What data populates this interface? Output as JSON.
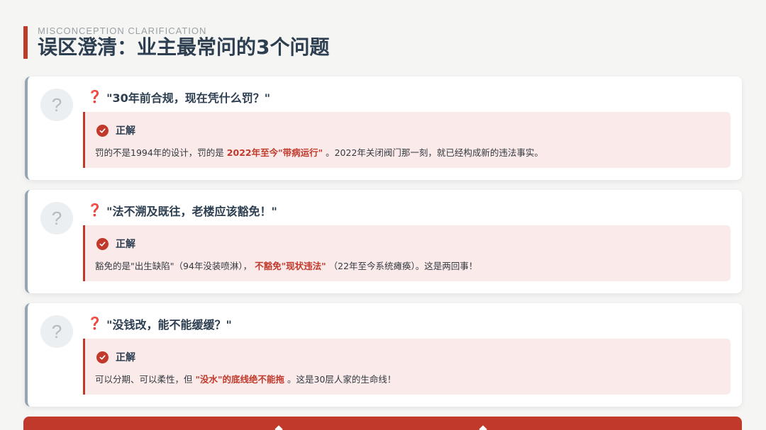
{
  "header": {
    "subtitle": "MISCONCEPTION CLARIFICATION",
    "title": "误区澄清：业主最常问的3个问题"
  },
  "cards": [
    {
      "question_mark": "?",
      "question_icon": "❓",
      "question": "\"30年前合规，现在凭什么罚？\"",
      "answer_label": "正解",
      "answer_before": "罚的不是1994年的设计，罚的是 ",
      "answer_highlight": "2022年至今\"带病运行\"",
      "answer_after": " 。2022年关闭阀门那一刻，就已经构成新的违法事实。"
    },
    {
      "question_mark": "?",
      "question_icon": "❓",
      "question": "\"法不溯及既往，老楼应该豁免！\"",
      "answer_label": "正解",
      "answer_before": "豁免的是\"出生缺陷\"（94年没装喷淋）， ",
      "answer_highlight": "不豁免\"现状违法\"",
      "answer_after": " （22年至今系统瘫痪）。这是两回事！"
    },
    {
      "question_mark": "?",
      "question_icon": "❓",
      "question": "\"没钱改，能不能缓缓？\"",
      "answer_label": "正解",
      "answer_before": "可以分期、可以柔性，但 ",
      "answer_highlight": "\"没水\"的底线绝不能拖",
      "answer_after": " 。这是30层人家的生命线！"
    }
  ],
  "colors": {
    "accent": "#c0392b",
    "title": "#2c3e50",
    "answer_bg": "#fbeaea",
    "question_icon": "#d6336c"
  },
  "icons": {
    "question_icon": "question-mark-icon",
    "answer_icon": "check-circle-icon"
  }
}
